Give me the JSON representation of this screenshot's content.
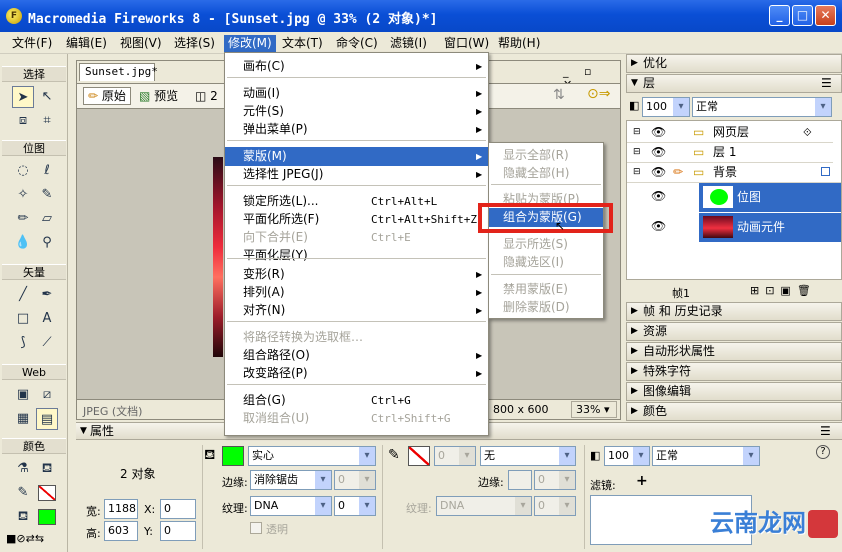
{
  "window": {
    "title": "Macromedia Fireworks 8 - [Sunset.jpg @  33% (2 对象)*]",
    "min": "_",
    "max": "□",
    "close": "✕"
  },
  "menubar": [
    "文件(F)",
    "编辑(E)",
    "视图(V)",
    "选择(S)",
    "修改(M)",
    "文本(T)",
    "命令(C)",
    "滤镜(I)",
    "窗口(W)",
    "帮助(H)"
  ],
  "toolbox": {
    "sections": [
      "选择",
      "位图",
      "矢量",
      "Web",
      "颜色"
    ]
  },
  "document": {
    "tab": "Sunset.jpg*",
    "views": [
      "原始",
      "预览",
      "2"
    ],
    "status_left": "JPEG (文档)",
    "status_size": "800 x 600",
    "status_zoom": "33%"
  },
  "modify_menu": {
    "items": [
      {
        "label": "画布(C)",
        "shortcut": "",
        "submenu": true,
        "disabled": false
      },
      {
        "label": "动画(I)",
        "shortcut": "",
        "submenu": true,
        "disabled": false
      },
      {
        "label": "元件(S)",
        "shortcut": "",
        "submenu": true,
        "disabled": false
      },
      {
        "label": "弹出菜单(P)",
        "shortcut": "",
        "submenu": true,
        "disabled": false
      },
      {
        "label": "蒙版(M)",
        "shortcut": "",
        "submenu": true,
        "disabled": false
      },
      {
        "label": "选择性 JPEG(J)",
        "shortcut": "",
        "submenu": true,
        "disabled": false
      },
      {
        "label": "锁定所选(L)...",
        "shortcut": "Ctrl+Alt+L",
        "submenu": false,
        "disabled": false
      },
      {
        "label": "平面化所选(F)",
        "shortcut": "Ctrl+Alt+Shift+Z",
        "submenu": false,
        "disabled": false
      },
      {
        "label": "向下合并(E)",
        "shortcut": "Ctrl+E",
        "submenu": false,
        "disabled": true
      },
      {
        "label": "平面化层(Y)",
        "shortcut": "",
        "submenu": false,
        "disabled": false
      },
      {
        "label": "变形(R)",
        "shortcut": "",
        "submenu": true,
        "disabled": false
      },
      {
        "label": "排列(A)",
        "shortcut": "",
        "submenu": true,
        "disabled": false
      },
      {
        "label": "对齐(N)",
        "shortcut": "",
        "submenu": true,
        "disabled": false
      },
      {
        "label": "将路径转换为选取框…",
        "shortcut": "",
        "submenu": false,
        "disabled": true
      },
      {
        "label": "组合路径(O)",
        "shortcut": "",
        "submenu": true,
        "disabled": false
      },
      {
        "label": "改变路径(P)",
        "shortcut": "",
        "submenu": true,
        "disabled": false
      },
      {
        "label": "组合(G)",
        "shortcut": "Ctrl+G",
        "submenu": false,
        "disabled": false
      },
      {
        "label": "取消组合(U)",
        "shortcut": "Ctrl+Shift+G",
        "submenu": false,
        "disabled": true
      }
    ]
  },
  "mask_submenu": {
    "items": [
      {
        "label": "显示全部(R)",
        "disabled": true
      },
      {
        "label": "隐藏全部(H)",
        "disabled": true
      },
      {
        "label": "粘贴为蒙版(P)",
        "disabled": true
      },
      {
        "label": "组合为蒙版(G)",
        "disabled": false
      },
      {
        "label": "显示所选(S)",
        "disabled": true
      },
      {
        "label": "隐藏选区(I)",
        "disabled": true
      },
      {
        "label": "禁用蒙版(E)",
        "disabled": true
      },
      {
        "label": "删除蒙版(D)",
        "disabled": true
      }
    ]
  },
  "panels": {
    "optimize": "优化",
    "layers": "层",
    "opacity": "100",
    "blend": "正常",
    "layer_rows": [
      {
        "name": "网页层"
      },
      {
        "name": "层 1"
      },
      {
        "name": "背景"
      }
    ],
    "objects": [
      {
        "name": "位图"
      },
      {
        "name": "动画元件"
      }
    ],
    "frame": "帧1",
    "collapsed": [
      "帧 和 历史记录",
      "资源",
      "自动形状属性",
      "特殊字符",
      "图像编辑",
      "颜色"
    ]
  },
  "properties": {
    "title": "属性",
    "summary": "2 对象",
    "width_label": "宽:",
    "width": "1188",
    "height_label": "高:",
    "height": "603",
    "x_label": "X:",
    "x": "0",
    "y_label": "Y:",
    "y": "0",
    "fill_type": "实心",
    "edge_label": "边缘:",
    "edge": "消除锯齿",
    "edge_val": "0",
    "texture_label": "纹理:",
    "texture": "DNA",
    "texture_val": "0",
    "transparent": "透明",
    "stroke_size": "0",
    "stroke_type": "无",
    "stroke_edge_label": "边缘:",
    "stroke_edge_val": "0",
    "stroke_texture_label": "纹理:",
    "stroke_texture": "DNA",
    "stroke_texture_val": "0",
    "opacity": "100",
    "blend": "正常",
    "filters_label": "滤镜:",
    "help": "?"
  },
  "colors": {
    "accent": "#316ac5",
    "fill": "#00ff00",
    "mask_highlight": "#e2231a"
  },
  "watermark": "云南龙网"
}
